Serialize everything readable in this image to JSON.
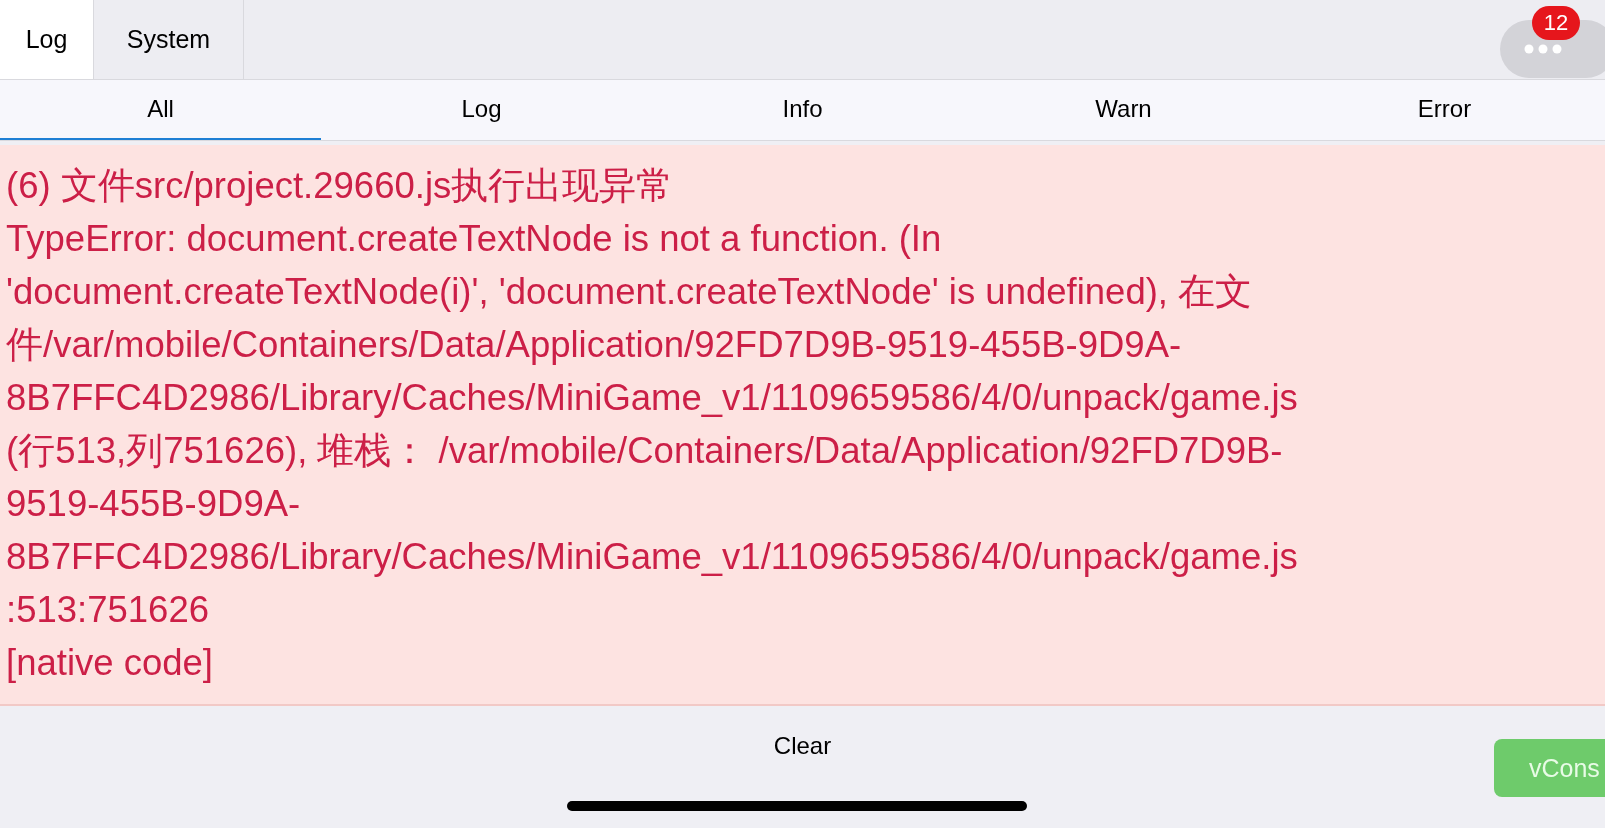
{
  "top_tabs": [
    {
      "label": "Log",
      "selected": true
    },
    {
      "label": "System",
      "selected": false
    }
  ],
  "menu_badge": "12",
  "filter_tabs": [
    {
      "label": "All",
      "selected": true
    },
    {
      "label": "Log",
      "selected": false
    },
    {
      "label": "Info",
      "selected": false
    },
    {
      "label": "Warn",
      "selected": false
    },
    {
      "label": "Error",
      "selected": false
    }
  ],
  "log_entries": [
    {
      "kind": "error",
      "lines": [
        "(6) 文件src/project.29660.js执行出现异常",
        "TypeError: document.createTextNode is not a function. (In",
        "'document.createTextNode(i)', 'document.createTextNode' is undefined), 在文",
        "件/var/mobile/Containers/Data/Application/92FD7D9B-9519-455B-9D9A-",
        "8B7FFC4D2986/Library/Caches/MiniGame_v1/1109659586/4/0/unpack/game.js",
        "(行513,列751626), 堆栈： /var/mobile/Containers/Data/Application/92FD7D9B-",
        "9519-455B-9D9A-",
        "8B7FFC4D2986/Library/Caches/MiniGame_v1/1109659586/4/0/unpack/game.js",
        ":513:751626",
        "[native code]"
      ]
    }
  ],
  "footer": {
    "clear_button": "Clear",
    "vconsole_button": "vCons"
  }
}
